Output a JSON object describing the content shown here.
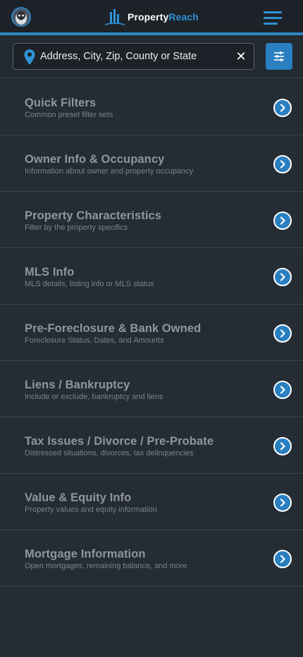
{
  "header": {
    "brand_part1": "Property",
    "brand_part2": "Reach"
  },
  "search": {
    "placeholder": "Address, City, Zip, County or State",
    "value": "",
    "clear_icon": "close-icon",
    "filter_icon": "sliders-icon"
  },
  "filters": [
    {
      "title": "Quick Filters",
      "subtitle": "Common preset filter sets"
    },
    {
      "title": "Owner Info & Occupancy",
      "subtitle": "Information about owner and property occupancy"
    },
    {
      "title": "Property Characteristics",
      "subtitle": "Filter by the property specifics"
    },
    {
      "title": "MLS Info",
      "subtitle": "MLS details, listing info or MLS status"
    },
    {
      "title": "Pre-Foreclosure & Bank Owned",
      "subtitle": "Foreclosure Status, Dates, and Amounts"
    },
    {
      "title": "Liens / Bankruptcy",
      "subtitle": "Include or exclude, bankruptcy and liens"
    },
    {
      "title": "Tax Issues / Divorce / Pre-Probate",
      "subtitle": "Distressed situations, divorces, tax delinquencies"
    },
    {
      "title": "Value & Equity Info",
      "subtitle": "Property values and equity information"
    },
    {
      "title": "Mortgage Information",
      "subtitle": "Open mortgages, remaining balance, and more"
    }
  ],
  "colors": {
    "accent": "#2f85c4",
    "background": "#252c33",
    "header_bg": "#1c2227"
  }
}
